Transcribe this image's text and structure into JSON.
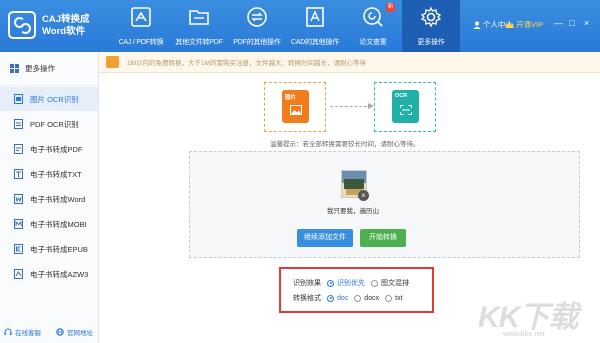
{
  "app": {
    "title_line1": "CAJ转换成",
    "title_line2": "Word软件"
  },
  "nav": [
    {
      "label": "CAJ / PDF转换",
      "icon": "pdf-convert-icon"
    },
    {
      "label": "其他文件转PDF",
      "icon": "folder-icon"
    },
    {
      "label": "PDF的其他操作",
      "icon": "swap-icon"
    },
    {
      "label": "CAD的其他操作",
      "icon": "cad-icon"
    },
    {
      "label": "论文查重",
      "icon": "check-icon",
      "badge": "新"
    },
    {
      "label": "更多操作",
      "icon": "gear-icon"
    }
  ],
  "header": {
    "user_center": "个人中心",
    "vip": "开通VIP",
    "win_controls": [
      "—",
      "□",
      "×"
    ]
  },
  "sidebar": {
    "header": "更多操作",
    "items": [
      {
        "label": "图片 OCR识别",
        "active": true
      },
      {
        "label": "PDF OCR识别"
      },
      {
        "label": "电子书转成PDF"
      },
      {
        "label": "电子书转成TXT"
      },
      {
        "label": "电子书转成Word"
      },
      {
        "label": "电子书转成MOBI"
      },
      {
        "label": "电子书转成EPUB"
      },
      {
        "label": "电子书转成AZW3"
      }
    ],
    "footer_service": "在线客服",
    "footer_website": "官网地址"
  },
  "notice": {
    "text": "1M以内的免费转换，大于1M的需购买注册，文件越大，转换时间越长，请耐心等待"
  },
  "flow": {
    "input_label": "图片",
    "output_label": "OCR"
  },
  "tip": "温馨提示：若全部转换需要较长时间，请耐心等待。",
  "file": {
    "name": "我只要我，遍历山"
  },
  "buttons": {
    "add": "继续添加文件",
    "start": "开始转换"
  },
  "settings": {
    "effect_label": "识别效果",
    "effect_options": [
      "识别优先",
      "图文混排"
    ],
    "effect_selected": 0,
    "format_label": "转换格式",
    "format_options": [
      "doc",
      "docx",
      "txt"
    ],
    "format_selected": 0
  },
  "watermark": {
    "brand": "KK下载",
    "url": "www.kkx.net"
  },
  "colors": {
    "primary": "#2a7ad8",
    "nav_active": "#1d5fb5",
    "add_button": "#3a8ee0",
    "start_button": "#4cb050",
    "highlight_border": "#e53935"
  }
}
